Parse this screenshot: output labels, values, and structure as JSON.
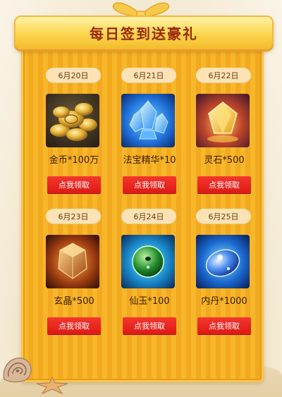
{
  "title": "每日签到送豪礼",
  "rewards": [
    {
      "date": "6月20日",
      "name": "金币*100万",
      "button": "点我领取",
      "icon": "gold-coins-icon"
    },
    {
      "date": "6月21日",
      "name": "法宝精华*10",
      "button": "点我领取",
      "icon": "blue-crystal-icon"
    },
    {
      "date": "6月22日",
      "name": "灵石*500",
      "button": "点我领取",
      "icon": "golden-gem-icon"
    },
    {
      "date": "6月23日",
      "name": "玄晶*500",
      "button": "点我领取",
      "icon": "amber-crystal-icon"
    },
    {
      "date": "6月24日",
      "name": "仙玉*100",
      "button": "点我领取",
      "icon": "jade-orb-icon"
    },
    {
      "date": "6月25日",
      "name": "内丹*1000",
      "button": "点我领取",
      "icon": "blue-pill-icon"
    }
  ],
  "colors": {
    "board": "#f7b72a",
    "button": "#e8221c",
    "pill": "#fbe3b5",
    "title_text": "#9a2a0c"
  }
}
